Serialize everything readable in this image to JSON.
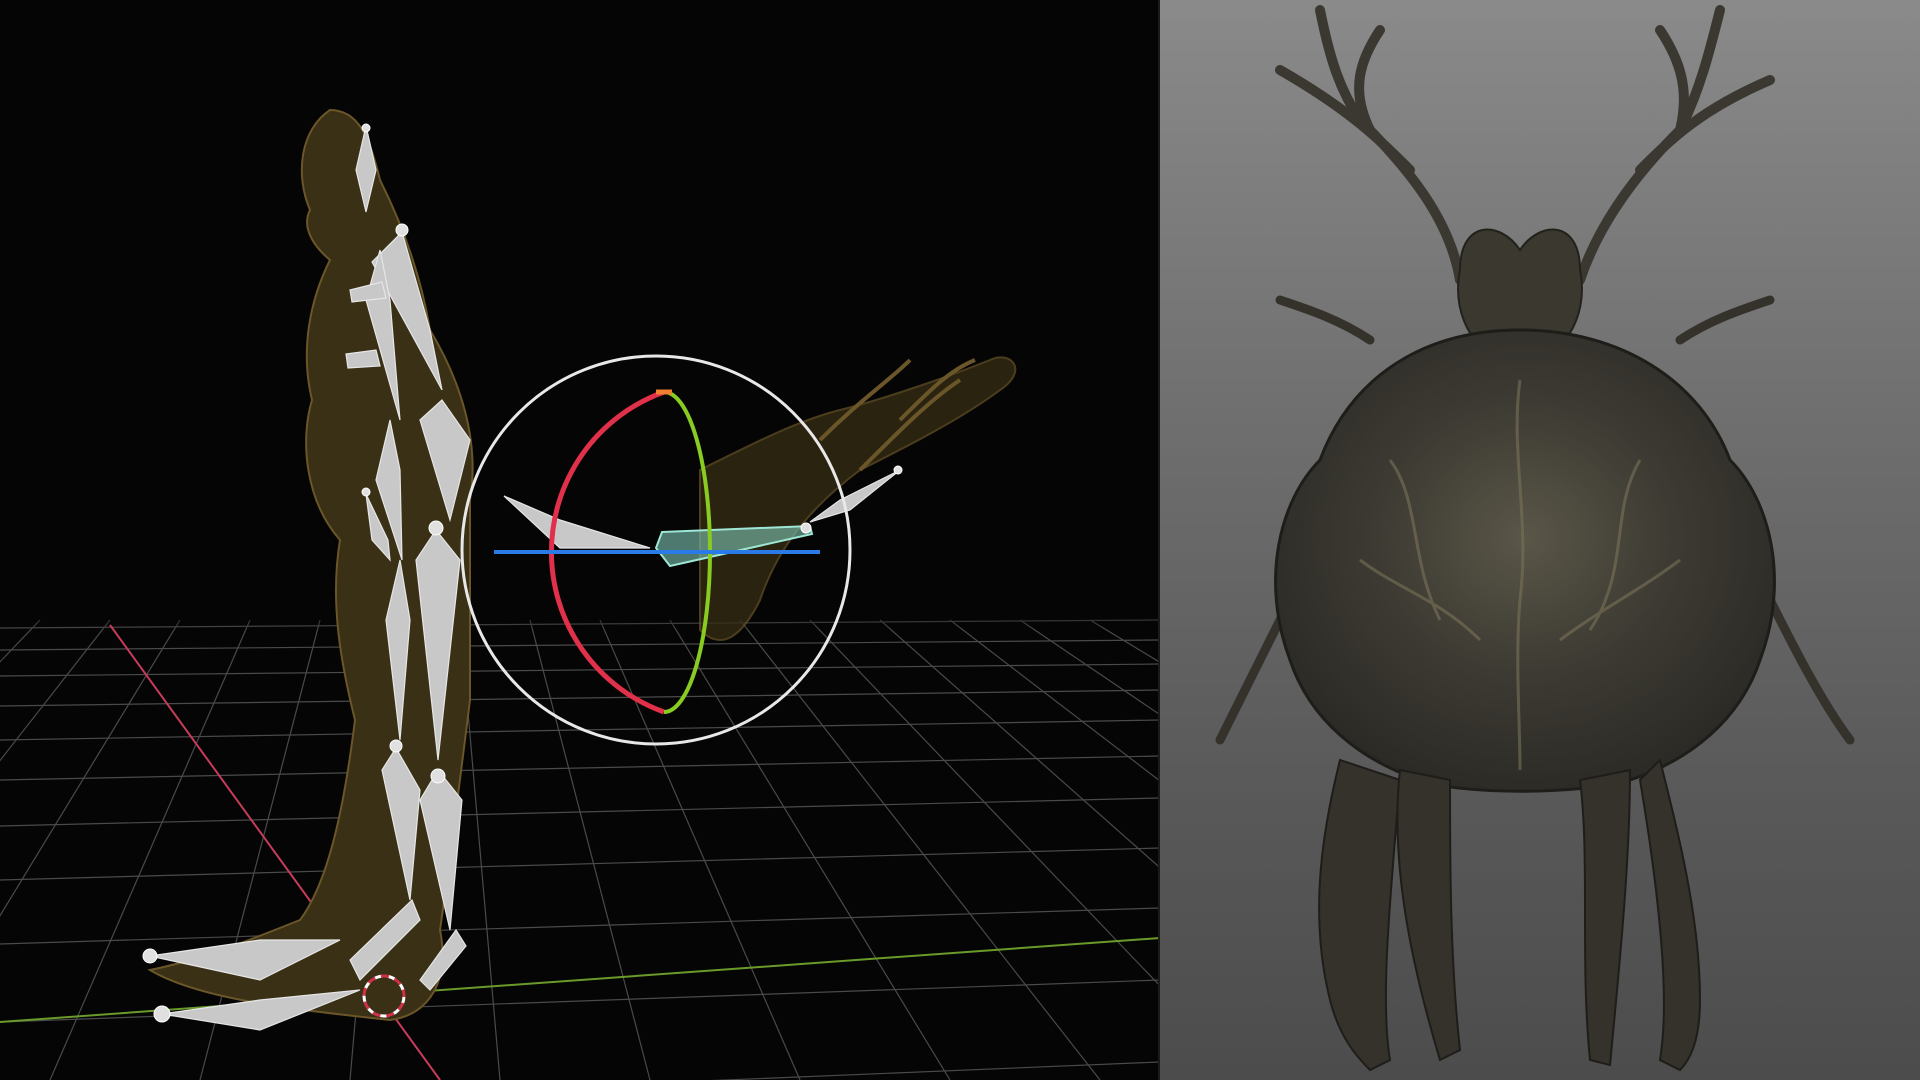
{
  "scene": {
    "left_viewport": {
      "description_icon": "armature-rig-icon",
      "gizmo": "rotate-gizmo-icon",
      "background_color": "#050505",
      "grid_color": "#4a4a4a",
      "x_axis_color": "#c83c5a",
      "y_axis_color": "#6a9a2a",
      "rig_color": "#c8c8c8",
      "active_bone_color": "#9ee6d6",
      "mesh_color": "#5a4a22"
    },
    "right_viewport": {
      "model_icon": "creature-model-icon",
      "mesh_color": "#3a3a34",
      "highlight_color": "#7a7258"
    },
    "gizmo_colors": {
      "ring": "#e8e8e8",
      "red_arc": "#e0304a",
      "green_arc": "#88cc22",
      "blue_axis": "#2a7ae8"
    }
  }
}
